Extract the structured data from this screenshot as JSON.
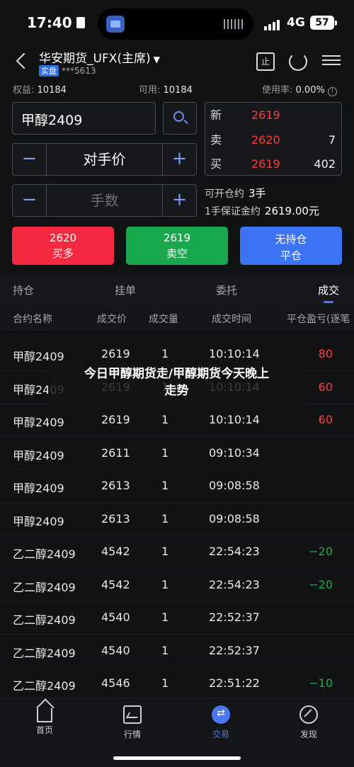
{
  "status_bar": {
    "time": "17:40",
    "network": "4G",
    "battery": "57"
  },
  "header": {
    "account_title": "华安期货_UFX(主席)",
    "account_tag": "实盘",
    "account_number": "***5613",
    "doc_icon_label": "止"
  },
  "account": {
    "equity_label": "权益:",
    "equity_value": "10184",
    "available_label": "可用:",
    "available_value": "10184",
    "usage_label": "使用率:",
    "usage_value": "0.00%"
  },
  "order_form": {
    "symbol": "甲醇2409",
    "price_mode": "对手价",
    "qty_placeholder": "手数",
    "minus": "−",
    "plus": "+"
  },
  "quote": {
    "last_label": "新",
    "last_price": "2619",
    "ask_label": "卖",
    "ask_price": "2620",
    "ask_vol": "7",
    "bid_label": "买",
    "bid_price": "2619",
    "bid_vol": "402"
  },
  "open_info": {
    "openable_label": "可开仓约",
    "openable_value": "3手",
    "margin_label": "1手保证金约",
    "margin_value": "2619.00元"
  },
  "actions": {
    "buy_price": "2620",
    "buy_label": "买多",
    "sell_price": "2619",
    "sell_label": "卖空",
    "close_title": "无持仓",
    "close_label": "平仓"
  },
  "tabs": [
    "持仓",
    "挂单",
    "委托",
    "成交"
  ],
  "columns": [
    "合约名称",
    "成交价",
    "成交量",
    "成交时间",
    "平仓盈亏(逐笔"
  ],
  "trades": [
    {
      "name": "甲醇2409",
      "price": "2619",
      "qty": "1",
      "time": "10:10:14",
      "pnl": "80",
      "sign": "pos"
    },
    {
      "name": "甲醇2409",
      "price": "2619",
      "qty": "1",
      "time": "10:10:14",
      "pnl": "60",
      "sign": "pos"
    },
    {
      "name": "甲醇2409",
      "price": "2619",
      "qty": "1",
      "time": "10:10:14",
      "pnl": "60",
      "sign": "pos"
    },
    {
      "name": "甲醇2409",
      "price": "2611",
      "qty": "1",
      "time": "09:10:34",
      "pnl": "",
      "sign": ""
    },
    {
      "name": "甲醇2409",
      "price": "2613",
      "qty": "1",
      "time": "09:08:58",
      "pnl": "",
      "sign": ""
    },
    {
      "name": "甲醇2409",
      "price": "2613",
      "qty": "1",
      "time": "09:08:58",
      "pnl": "",
      "sign": ""
    },
    {
      "name": "乙二醇2409",
      "price": "4542",
      "qty": "1",
      "time": "22:54:23",
      "pnl": "−20",
      "sign": "neg"
    },
    {
      "name": "乙二醇2409",
      "price": "4542",
      "qty": "1",
      "time": "22:54:23",
      "pnl": "−20",
      "sign": "neg"
    },
    {
      "name": "乙二醇2409",
      "price": "4540",
      "qty": "1",
      "time": "22:52:37",
      "pnl": "",
      "sign": ""
    },
    {
      "name": "乙二醇2409",
      "price": "4540",
      "qty": "1",
      "time": "22:52:37",
      "pnl": "",
      "sign": ""
    },
    {
      "name": "乙二醇2409",
      "price": "4546",
      "qty": "1",
      "time": "22:51:22",
      "pnl": "−10",
      "sign": "neg"
    }
  ],
  "banner": {
    "line1": "今日甲醇期货走/甲醇期货今天晚上",
    "line2": "走势"
  },
  "bottom_nav": [
    {
      "label": "首页",
      "icon": "home-icon"
    },
    {
      "label": "行情",
      "icon": "chart-icon"
    },
    {
      "label": "交易",
      "icon": "trade-icon"
    },
    {
      "label": "发现",
      "icon": "discover-icon"
    }
  ],
  "colors": {
    "up": "#ff3b3b",
    "down": "#18b04a",
    "accent": "#4a78f0",
    "buy": "#f5293f",
    "sell": "#1aa84f",
    "close": "#3d73f5"
  }
}
